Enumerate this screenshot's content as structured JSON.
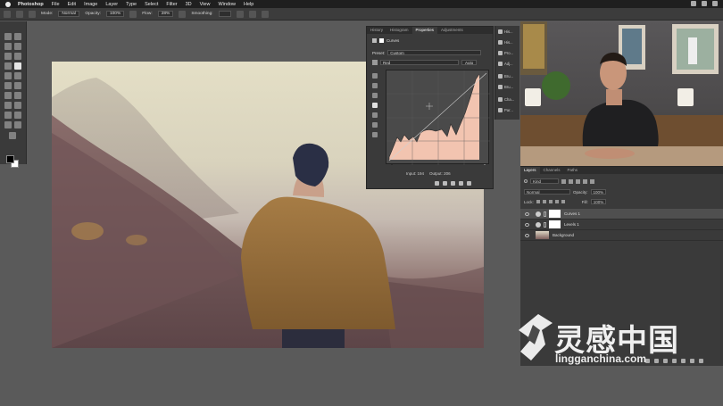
{
  "menubar": {
    "items": [
      "Photoshop",
      "File",
      "Edit",
      "Image",
      "Layer",
      "Type",
      "Select",
      "Filter",
      "3D",
      "View",
      "Window",
      "Help"
    ]
  },
  "options_bar": {
    "mode_label": "Mode:",
    "mode_value": "Normal",
    "opacity_label": "Opacity:",
    "opacity_value": "100%",
    "flow_label": "Flow:",
    "flow_value": "28%",
    "smoothing_label": "Smoothing:"
  },
  "properties": {
    "tabs": [
      "History",
      "Histogram",
      "Properties",
      "Adjustments"
    ],
    "active_tab": "Properties",
    "title": "Curves",
    "preset_label": "Preset:",
    "preset_value": "Custom",
    "channel_value": "Red",
    "auto_label": "Auto",
    "input_label": "Input:",
    "input_value": "194",
    "output_label": "Output:",
    "output_value": "206"
  },
  "strip": [
    "His...",
    "His...",
    "Pro...",
    "Adj...",
    "Bru...",
    "Bru...",
    "Cha...",
    "Par..."
  ],
  "layers": {
    "tabs": [
      "Layers",
      "Channels",
      "Paths"
    ],
    "kind_label": "Kind",
    "blend_value": "Normal",
    "opacity_label": "Opacity:",
    "opacity_value": "100%",
    "lock_label": "Lock:",
    "fill_label": "Fill:",
    "fill_value": "100%",
    "items": [
      {
        "name": "Curves 1",
        "type": "adjustment",
        "selected": true
      },
      {
        "name": "Levels 1",
        "type": "adjustment",
        "selected": false
      },
      {
        "name": "Background",
        "type": "image",
        "selected": false
      }
    ]
  },
  "watermark": {
    "chinese": "灵感中国",
    "url": "lingganchina.com"
  },
  "colors": {
    "curve_fill": "#f2c4b0",
    "ui_dark": "#3a3a3a",
    "workspace": "#5a5a5a"
  }
}
